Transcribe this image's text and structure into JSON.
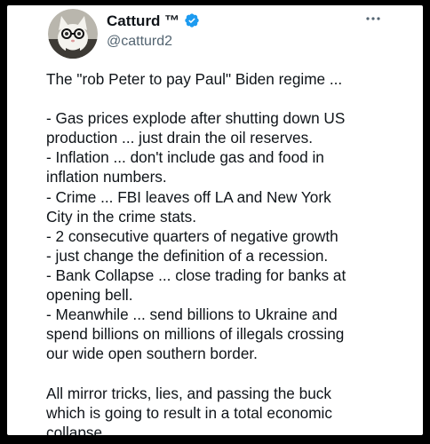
{
  "author": {
    "name": "Catturd ™",
    "handle": "@catturd2"
  },
  "tweet": {
    "lines": [
      "The \"rob Peter to pay Paul\" Biden regime ...",
      "",
      " - Gas prices explode after shutting down US",
      "production ...  just drain the oil reserves.",
      " - Inflation ... don't include gas and food in",
      "inflation numbers.",
      " - Crime ... FBI leaves off LA and New York",
      "City in the crime stats.",
      " -  2 consecutive quarters of negative growth",
      " - just change the definition of a recession.",
      " - Bank Collapse ... close trading for banks at",
      "opening bell.",
      " - Meanwhile ... send billions to Ukraine and",
      "spend billions on millions of illegals crossing",
      "our wide open southern border.",
      "",
      "All mirror tricks, lies, and passing the buck",
      "which is going to result in a total economic",
      "collapse."
    ]
  },
  "colors": {
    "verified": "#1d9bf0",
    "text": "#0f1419",
    "secondary": "#536471"
  },
  "icons": {
    "verified": "verified-badge-icon",
    "more": "more-options-icon"
  }
}
